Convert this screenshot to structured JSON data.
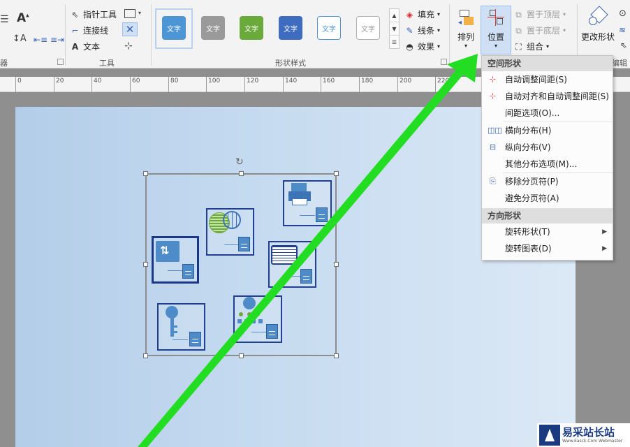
{
  "ribbon": {
    "tools": {
      "pointer": "指针工具",
      "connector": "连接线",
      "text": "文本",
      "group_label": "工具"
    },
    "shape_styles": {
      "group_label": "形状样式",
      "swatch_text": "文字",
      "fill": "填充",
      "line": "线条",
      "effect": "效果",
      "swatch_colors": [
        "#4d96d6",
        "#9a9a9a",
        "#6aaa3a",
        "#3e6cc0",
        "#4d96d6",
        "#b0b0b0"
      ]
    },
    "arrange": {
      "arrange_label": "排列",
      "position_label": "位置",
      "bring_front": "置于顶层",
      "send_back": "置于底层",
      "group": "组合",
      "change_shape": "更改形状",
      "edit_label": "编辑"
    },
    "left_partial": {
      "label_fragment": "器"
    }
  },
  "ruler": {
    "labels": [
      "0",
      "20",
      "40",
      "60",
      "80",
      "100",
      "120",
      "140",
      "160",
      "180",
      "200",
      "220"
    ]
  },
  "menu": {
    "section_spacing": "空间形状",
    "auto_space": "自动调整间距(S)",
    "auto_align_space": "自动对齐和自动调整间距(S)",
    "spacing_options": "间距选项(O)...",
    "distribute_h": "横向分布(H)",
    "distribute_v": "纵向分布(V)",
    "other_distribute": "其他分布选项(M)...",
    "remove_page_breaks": "移除分页符(P)",
    "avoid_page_breaks": "避免分页符(A)",
    "section_orient": "方向形状",
    "rotate_shape": "旋转形状(T)",
    "rotate_diagram": "旋转图表(D)"
  },
  "watermark": {
    "title": "易采站长站",
    "subtitle": "Www.Easck.Com Webmaster"
  },
  "colors": {
    "accent_green": "#22dd22",
    "tile_border": "#233f8f",
    "selected_tab": "#cfe0f4"
  }
}
